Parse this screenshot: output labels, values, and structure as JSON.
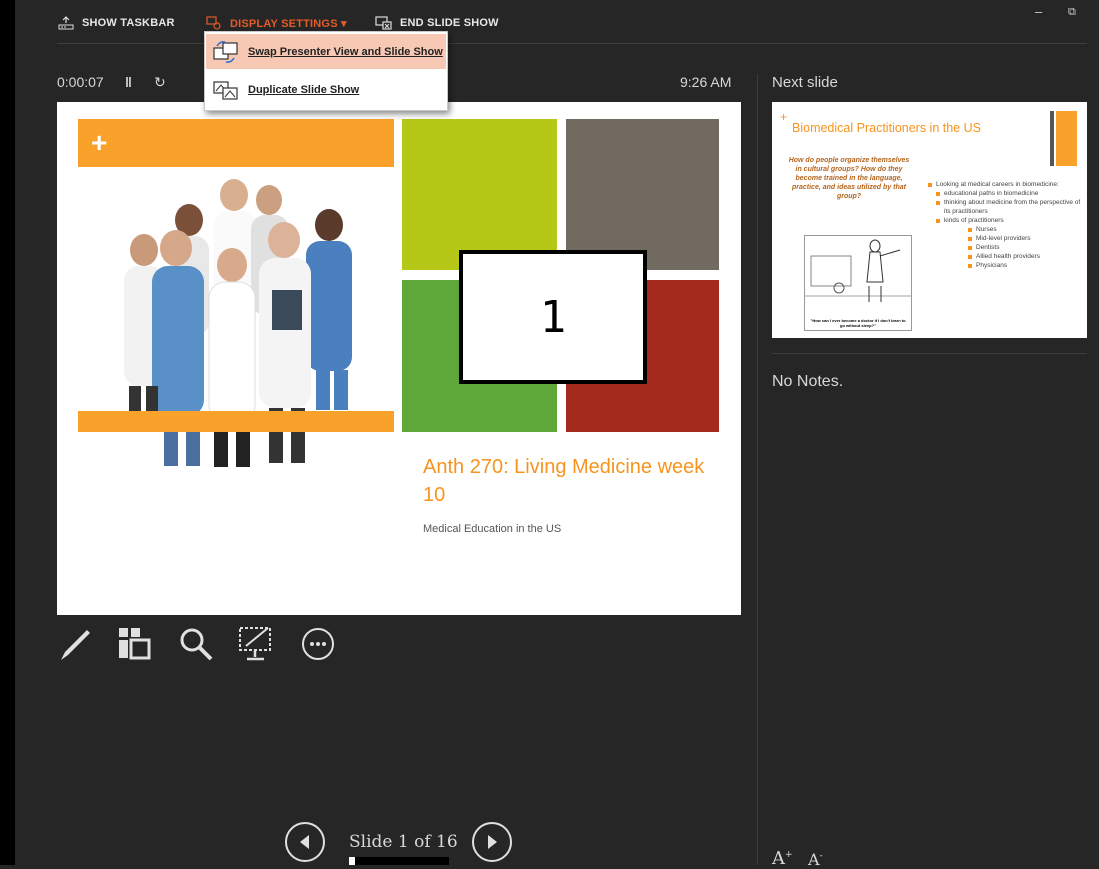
{
  "toolbar": {
    "show_taskbar": "SHOW TASKBAR",
    "display_settings": "DISPLAY SETTINGS ▾",
    "end_slide_show": "END SLIDE SHOW"
  },
  "window": {
    "minimize": "–",
    "restore": "⧉"
  },
  "display_menu": {
    "items": [
      {
        "label": "Swap Presenter View and Slide Show",
        "highlighted": true
      },
      {
        "label": "Duplicate Slide Show",
        "highlighted": false
      }
    ]
  },
  "status": {
    "timer": "0:00:07",
    "pause": "‖",
    "restart": "↻",
    "clock": "9:26 AM"
  },
  "current_slide": {
    "title": "Anth 270: Living Medicine week 10",
    "subtitle": "Medical Education in the US",
    "display_number": "1",
    "colors": {
      "orange": "#f9a12b",
      "lime": "#b5c818",
      "taupe": "#716a61",
      "green": "#5ea83a",
      "red": "#a52a1e"
    }
  },
  "next_slide": {
    "label": "Next slide",
    "title": "Biomedical Practitioners in the US",
    "question": "How do people organize themselves in cultural groups? How do they become trained in the language, practice, and ideas utilized by that group?",
    "bullets": [
      {
        "level": 1,
        "text": "Looking at medical careers in biomedicine:"
      },
      {
        "level": 2,
        "text": "educational paths in biomedicine"
      },
      {
        "level": 2,
        "text": "thinking about medicine from the perspective of its practitioners"
      },
      {
        "level": 2,
        "text": "kinds of practitioners"
      },
      {
        "level": 3,
        "text": "Nurses"
      },
      {
        "level": 3,
        "text": "Mid-level providers"
      },
      {
        "level": 3,
        "text": "Dentists"
      },
      {
        "level": 3,
        "text": "Allied health providers"
      },
      {
        "level": 3,
        "text": "Physicians"
      }
    ],
    "cartoon_caption": "\"How can I ever become a doctor if I don't learn to go without sleep?\""
  },
  "notes": {
    "text": "No Notes."
  },
  "navigation": {
    "slide_counter": "Slide 1 of 16",
    "progress": 0.0625
  },
  "font_controls": {
    "increase": "A",
    "decrease": "A"
  },
  "tools": [
    "pen-icon",
    "see-all-slides-icon",
    "zoom-icon",
    "black-screen-icon",
    "more-options-icon"
  ]
}
